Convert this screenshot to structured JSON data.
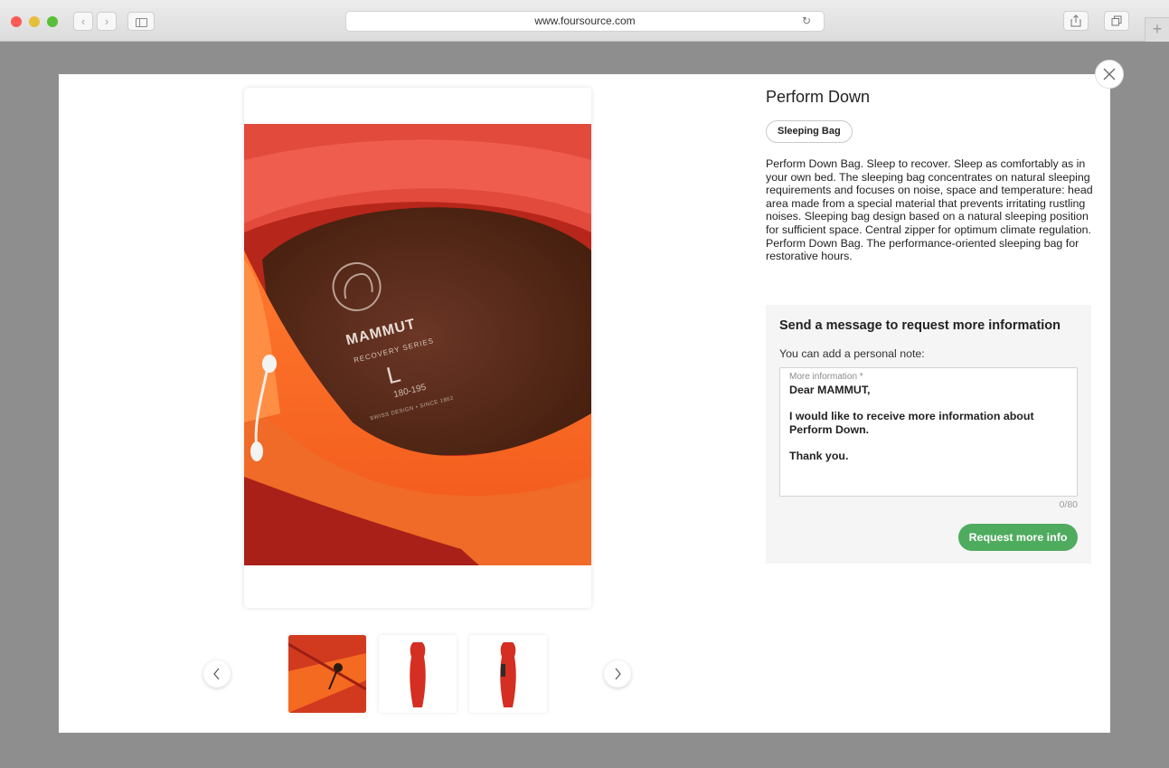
{
  "browser": {
    "url": "www.foursource.com"
  },
  "product": {
    "title": "Perform Down",
    "tag": "Sleeping Bag",
    "description": "Perform Down Bag. Sleep to recover. Sleep as comfortably as in your own bed. The sleeping bag concentrates on natural sleeping requirements and focuses on noise, space and temperature: head area made from a special material that prevents irritating rustling noises. Sleeping bag design based on a natural sleeping position for sufficient space. Central zipper for optimum climate regulation. Perform Down Bag. The performance-oriented sleeping bag for restorative hours.",
    "image_label": {
      "brand": "MAMMUT",
      "series": "RECOVERY SERIES",
      "size": "L",
      "range": "180-195",
      "tagline": "SWISS DESIGN • SINCE 1862"
    }
  },
  "request": {
    "title": "Send a message to request more information",
    "subtitle": "You can add a personal note:",
    "field_label": "More information *",
    "field_value": "Dear MAMMUT,\n\nI would like to receive more information about Perform Down.\n\nThank you.",
    "counter": "0/80",
    "button_label": "Request more info"
  },
  "colors": {
    "accent_green": "#4fac5f",
    "product_red": "#c72d20",
    "product_orange": "#f5661c"
  },
  "icons": {
    "close": "close-icon",
    "prev": "chevron-left-icon",
    "next": "chevron-right-icon",
    "share": "share-icon",
    "tabs": "tabs-icon",
    "reload": "reload-icon"
  }
}
